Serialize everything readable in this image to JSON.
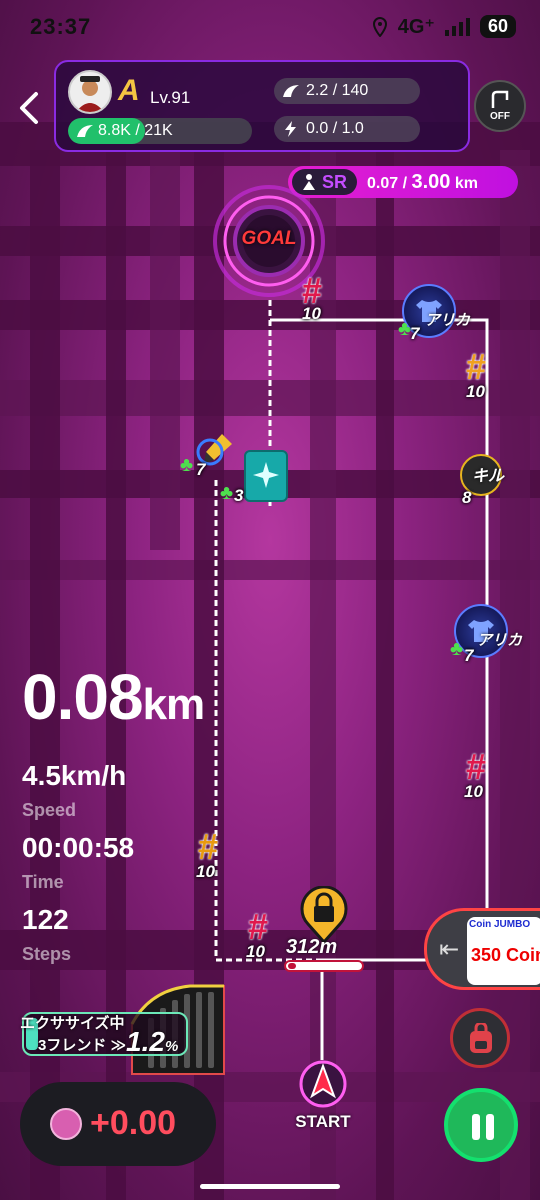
{
  "status_bar": {
    "time": "23:37",
    "network": "4G⁺",
    "battery": "60"
  },
  "header": {
    "rank": "A",
    "level": "Lv.91",
    "energy": "8.8K / 21K",
    "energy_fraction": 0.42,
    "stat_top": "2.2 / 140",
    "stat_bottom": "0.0 / 1.0",
    "off_label": "OFF"
  },
  "sr": {
    "badge": "SR",
    "current": "0.07 / ",
    "target": "3.00",
    "unit": "km"
  },
  "goal_label": "GOAL",
  "markers": [
    {
      "name": "badge-top",
      "value": "10"
    },
    {
      "name": "tshirt-top",
      "value": "7",
      "label": "アリカ"
    },
    {
      "name": "badge-right-1",
      "value": "10"
    },
    {
      "name": "skill-right",
      "value": "8",
      "label": "キル"
    },
    {
      "name": "tshirt-mid",
      "value": "7",
      "label": "アリカ"
    },
    {
      "name": "badge-right-2",
      "value": "10"
    },
    {
      "name": "brush-left",
      "value": "7"
    },
    {
      "name": "scroll-left",
      "value": "3"
    },
    {
      "name": "badge-left-1",
      "value": "10"
    },
    {
      "name": "badge-left-2",
      "value": "10"
    }
  ],
  "lock": {
    "distance": "312m",
    "progress_fraction": 0.08
  },
  "stats": {
    "distance_value": "0.08",
    "distance_unit": "km",
    "speed": "4.5km/h",
    "speed_label": "Speed",
    "time": "00:00:58",
    "time_label": "Time",
    "steps": "122",
    "steps_label": "Steps"
  },
  "exercise": {
    "title": "エクササイズ中",
    "friend": "3フレンド ≫",
    "percent": "1.2",
    "percent_sign": "%"
  },
  "coin": {
    "value": "+0.00"
  },
  "jumbo": {
    "title": "Coin JUMBO",
    "subtitle": "350 Coin"
  },
  "start_label": "START",
  "colors": {
    "accent": "#c010e0",
    "route": "#ffffff",
    "pause": "#1fb85a",
    "danger": "#ff4d5e"
  }
}
